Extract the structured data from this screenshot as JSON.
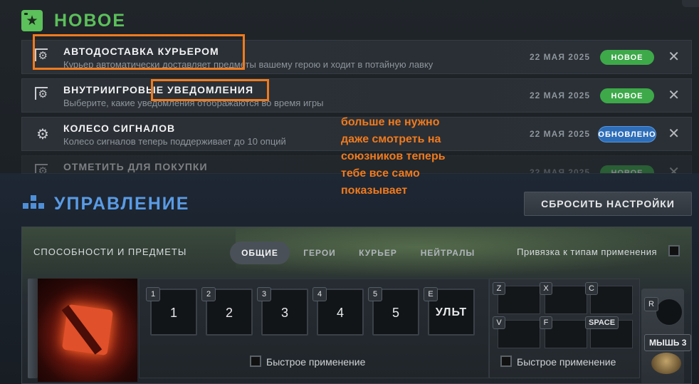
{
  "new_section": {
    "title": "НОВОЕ",
    "items": [
      {
        "title": "АВТОДОСТАВКА КУРЬЕРОМ",
        "desc": "Курьер автоматически доставляет предметы вашему герою и ходит в потайную лавку",
        "date": "22 МАЯ 2025",
        "badge": "НОВОЕ"
      },
      {
        "title": "ВНУТРИИГРОВЫЕ УВЕДОМЛЕНИЯ",
        "desc": "Выберите, какие уведомления отображаются во время игры",
        "date": "22 МАЯ 2025",
        "badge": "НОВОЕ"
      },
      {
        "title": "КОЛЕСО СИГНАЛОВ",
        "desc": "Колесо сигналов теперь поддерживает до 10 опций",
        "date": "22 МАЯ 2025",
        "badge": "ОБНОВЛЕНО"
      },
      {
        "title": "ОТМЕТИТЬ ДЛЯ ПОКУПКИ",
        "desc": "",
        "date": "22 МАЯ 2025",
        "badge": "НОВОЕ"
      }
    ],
    "close_glyph": "✕"
  },
  "annotation": {
    "lines": [
      "больше не нужно",
      "даже смотреть на",
      "союзников теперь",
      "тебе все само",
      "показывает"
    ]
  },
  "controls": {
    "title": "УПРАВЛЕНИЕ",
    "reset_label": "СБРОСИТЬ НАСТРОЙКИ",
    "abilities_label": "СПОСОБНОСТИ И ПРЕДМЕТЫ",
    "tabs": [
      "ОБЩИЕ",
      "ГЕРОИ",
      "КУРЬЕР",
      "НЕЙТРАЛЫ"
    ],
    "active_tab": "ОБЩИЕ",
    "bind_label": "Привязка к типам применения",
    "ability_keys": [
      {
        "hotkey": "1",
        "label": "1"
      },
      {
        "hotkey": "2",
        "label": "2"
      },
      {
        "hotkey": "3",
        "label": "3"
      },
      {
        "hotkey": "4",
        "label": "4"
      },
      {
        "hotkey": "5",
        "label": "5"
      },
      {
        "hotkey": "E",
        "label": "УЛЬТ"
      }
    ],
    "item_keys": [
      "Z",
      "X",
      "C",
      "V",
      "F",
      "SPACE"
    ],
    "r_key": "R",
    "mouse_key": "МЫШЬ 3",
    "quick_cast_label": "Быстрое применение"
  },
  "colors": {
    "new_accent": "#5cc05b",
    "controls_accent": "#5a9be5",
    "annotation": "#f07a1d",
    "badge_new": "#3da949",
    "badge_updated": "#2e6db8"
  }
}
